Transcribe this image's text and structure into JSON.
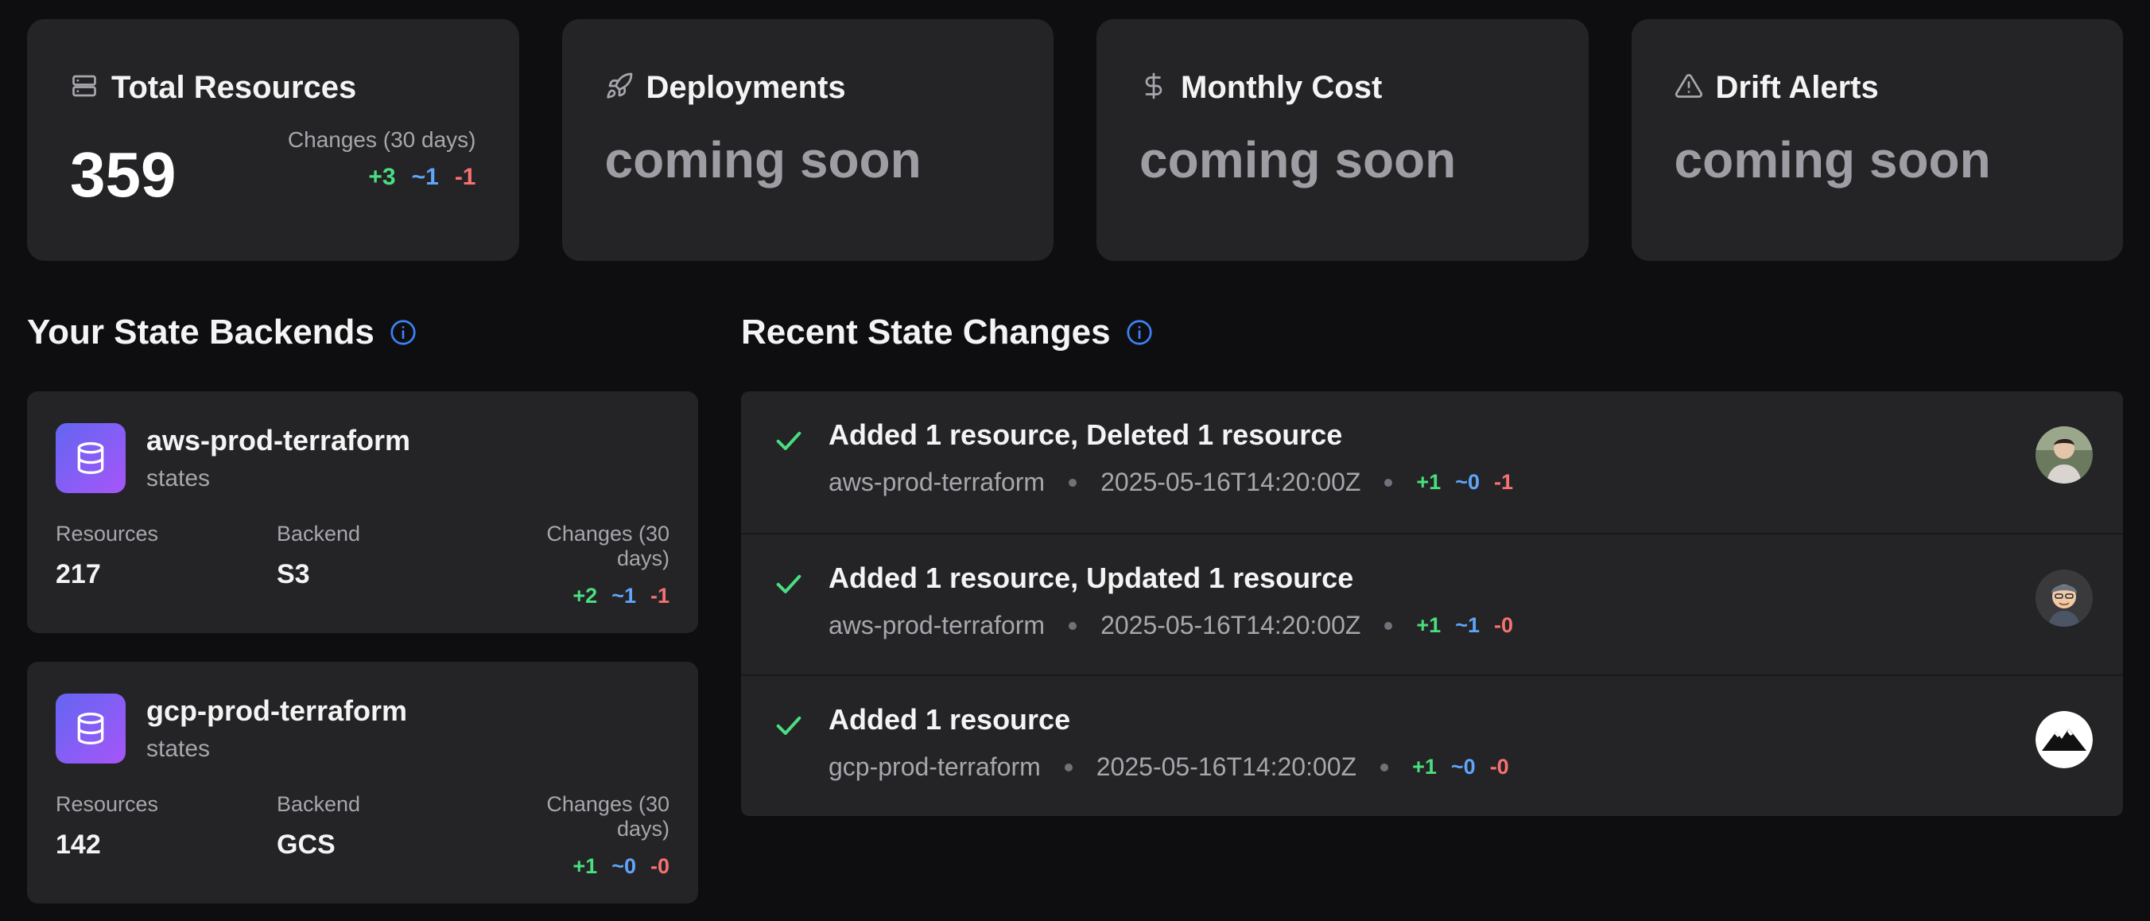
{
  "stats": {
    "total": {
      "title": "Total Resources",
      "icon": "server-icon",
      "value": "359",
      "changes_label": "Changes (30 days)",
      "added": "+3",
      "updated": "~1",
      "deleted": "-1"
    },
    "deployments": {
      "title": "Deployments",
      "icon": "rocket-icon",
      "value": "coming soon"
    },
    "cost": {
      "title": "Monthly Cost",
      "icon": "dollar-icon",
      "value": "coming soon"
    },
    "drift": {
      "title": "Drift Alerts",
      "icon": "warning-icon",
      "value": "coming soon"
    }
  },
  "backends": {
    "heading": "Your State Backends",
    "items": [
      {
        "name": "aws-prod-terraform",
        "sub": "states",
        "resources_label": "Resources",
        "resources": "217",
        "backend_label": "Backend",
        "backend": "S3",
        "changes_label": "Changes (30 days)",
        "added": "+2",
        "updated": "~1",
        "deleted": "-1"
      },
      {
        "name": "gcp-prod-terraform",
        "sub": "states",
        "resources_label": "Resources",
        "resources": "142",
        "backend_label": "Backend",
        "backend": "GCS",
        "changes_label": "Changes (30 days)",
        "added": "+1",
        "updated": "~0",
        "deleted": "-0"
      }
    ]
  },
  "recent": {
    "heading": "Recent State Changes",
    "items": [
      {
        "title": "Added 1 resource, Deleted 1 resource",
        "backend": "aws-prod-terraform",
        "timestamp": "2025-05-16T14:20:00Z",
        "added": "+1",
        "updated": "~0",
        "deleted": "-1"
      },
      {
        "title": "Added 1 resource, Updated 1 resource",
        "backend": "aws-prod-terraform",
        "timestamp": "2025-05-16T14:20:00Z",
        "added": "+1",
        "updated": "~1",
        "deleted": "-0"
      },
      {
        "title": "Added 1 resource",
        "backend": "gcp-prod-terraform",
        "timestamp": "2025-05-16T14:20:00Z",
        "added": "+1",
        "updated": "~0",
        "deleted": "-0"
      }
    ]
  },
  "colors": {
    "added": "#4ade80",
    "updated": "#60a5fa",
    "deleted": "#f87171",
    "accent": "#8b5cf6"
  }
}
